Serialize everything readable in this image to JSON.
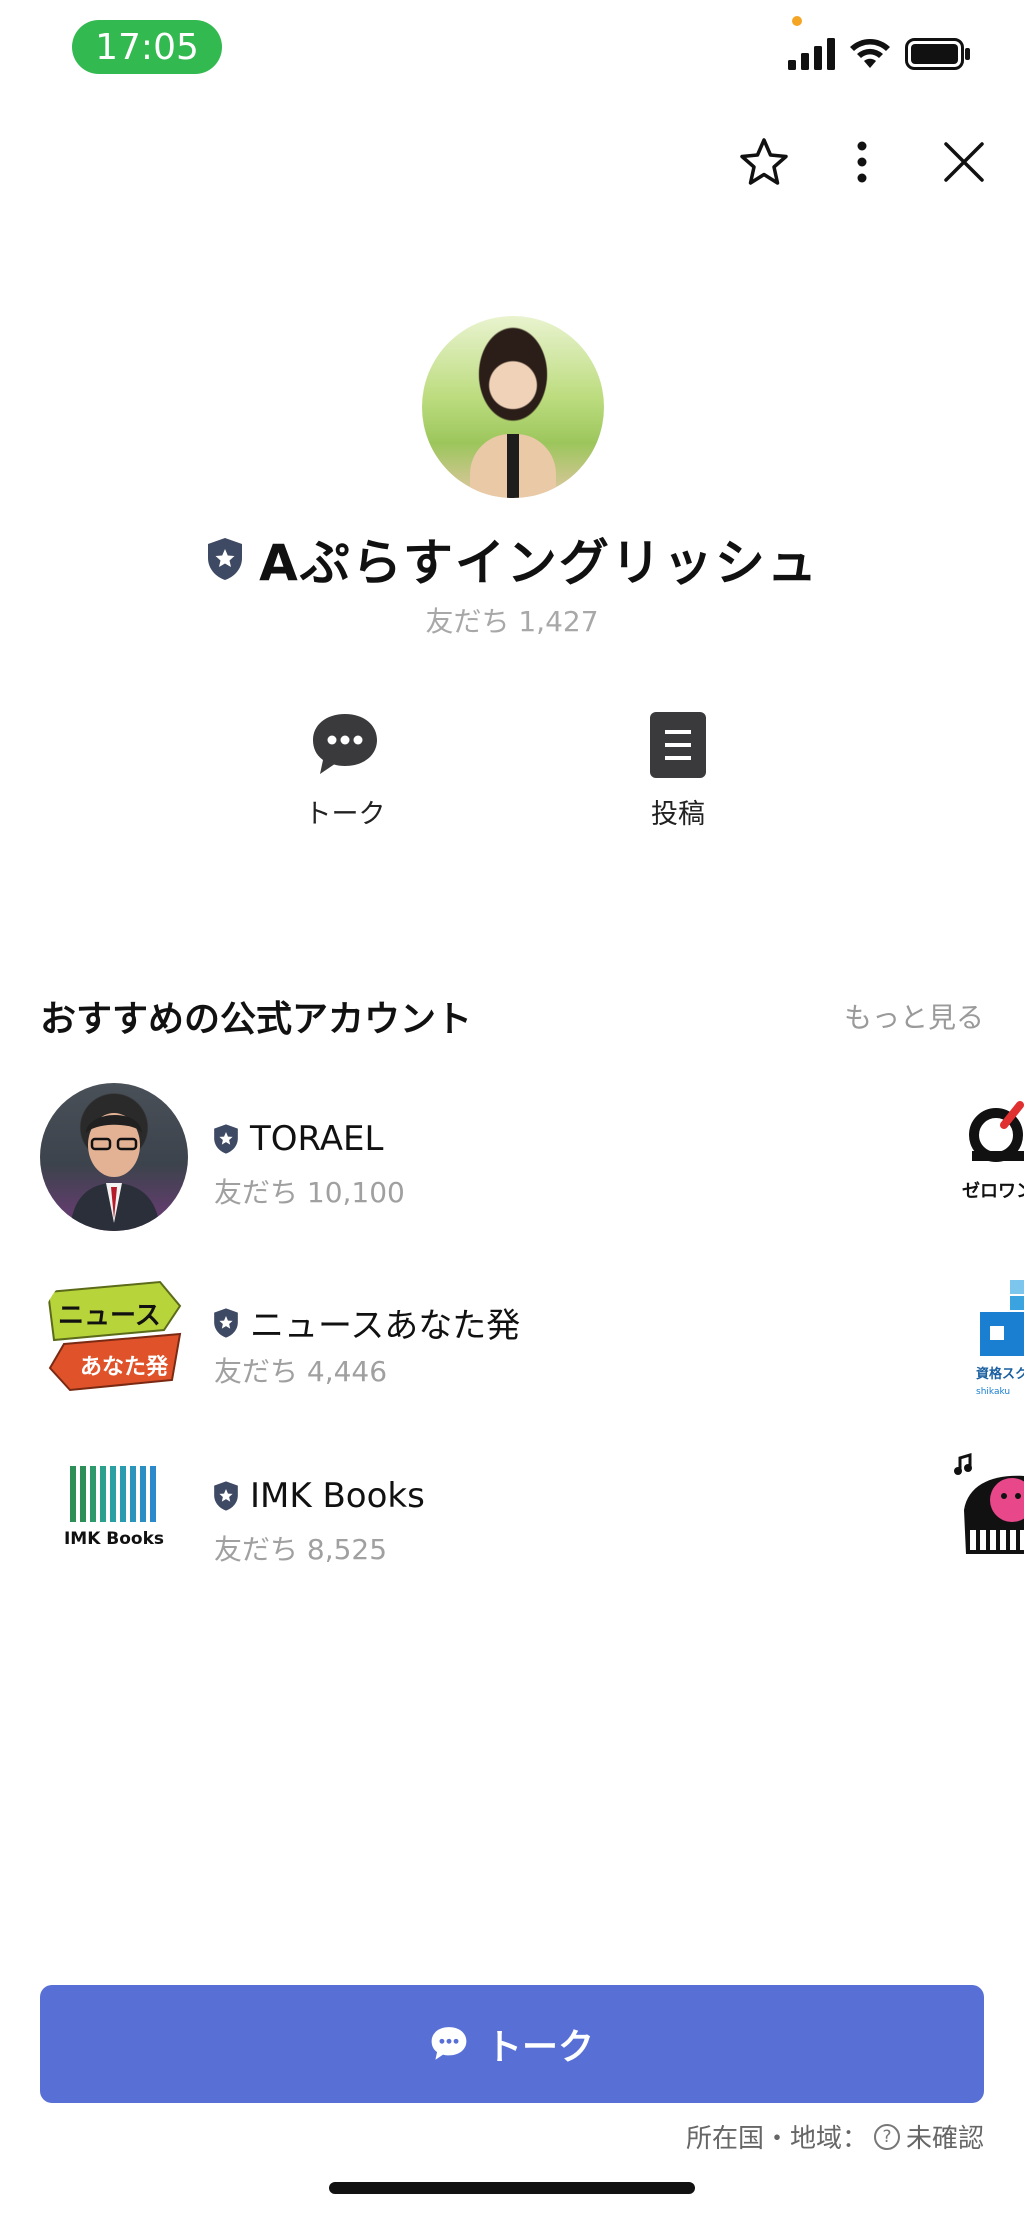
{
  "status_bar": {
    "time": "17:05",
    "icons": [
      "cellular-signal-icon",
      "wifi-icon",
      "battery-icon"
    ]
  },
  "top_actions": {
    "icons": [
      "star-icon",
      "more-vertical-icon",
      "close-icon"
    ]
  },
  "profile": {
    "name": "Aぷらすイングリッシュ",
    "friends": "友だち 1,427",
    "verified_icon": "official-shield-icon"
  },
  "actions": [
    {
      "label": "トーク",
      "icon": "chat-bubble-icon"
    },
    {
      "label": "投稿",
      "icon": "post-icon"
    }
  ],
  "recommended": {
    "title": "おすすめの公式アカウント",
    "see_more": "もっと見る",
    "items": [
      {
        "name": "TORAEL",
        "friends": "友だち 10,100"
      },
      {
        "name": "ニュースあなた発",
        "friends": "友だち 4,446",
        "avatar_text": "ニュース",
        "avatar_text2": "あなた発"
      },
      {
        "name": "IMK Books",
        "friends": "友だち 8,525",
        "avatar_text": "IMK Books"
      }
    ],
    "peek_items": [
      {
        "text": "ゼロワン"
      },
      {
        "text": "資格スク",
        "subtext": "shikaku"
      },
      {
        "text": ""
      }
    ]
  },
  "bottom": {
    "talk_button": "トーク",
    "region_label": "所在国・地域：",
    "region_value": "未確認",
    "help_symbol": "?"
  },
  "colors": {
    "status_time_bg": "#32b94f",
    "talk_button_bg": "#5870d6",
    "shield": "#3e4a63"
  }
}
